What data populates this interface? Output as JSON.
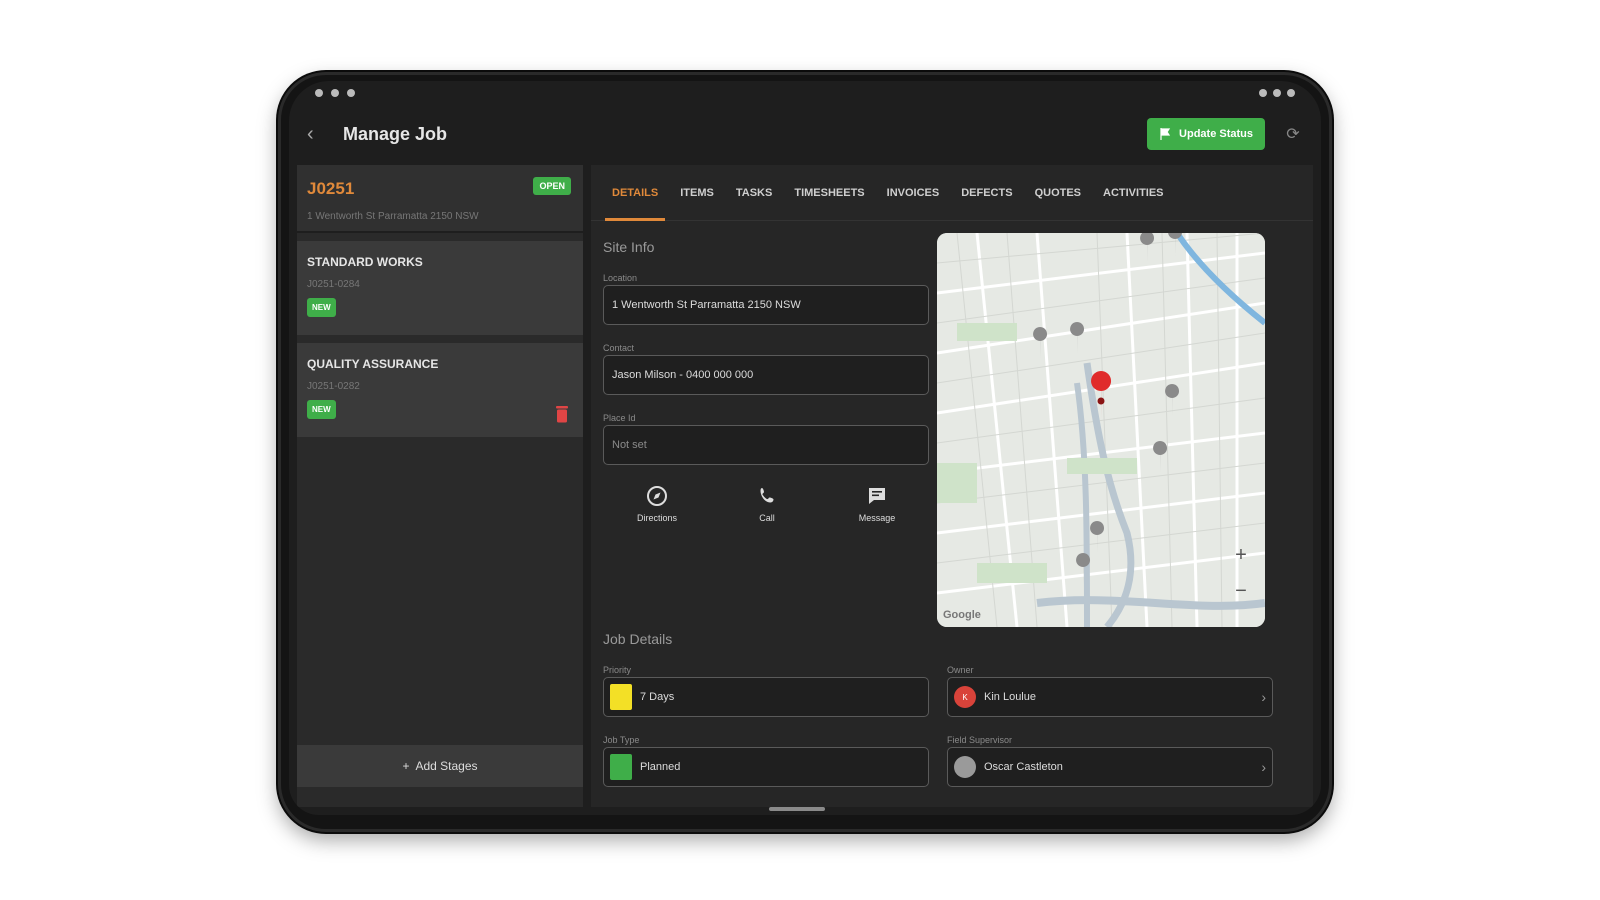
{
  "app": {
    "title": "Manage Job",
    "update_status_label": "Update Status"
  },
  "job": {
    "code": "J0251",
    "status": "OPEN",
    "address": "1 Wentworth St Parramatta 2150 NSW"
  },
  "stages": [
    {
      "title": "STANDARD WORKS",
      "code": "J0251-0284",
      "badge": "NEW"
    },
    {
      "title": "QUALITY ASSURANCE",
      "code": "J0251-0282",
      "badge": "NEW"
    }
  ],
  "add_stages_label": "Add Stages",
  "tabs": [
    "DETAILS",
    "ITEMS",
    "TASKS",
    "TIMESHEETS",
    "INVOICES",
    "DEFECTS",
    "QUOTES",
    "ACTIVITIES"
  ],
  "site_info": {
    "title": "Site Info",
    "location_label": "Location",
    "location_value": "1 Wentworth St Parramatta 2150 NSW",
    "contact_label": "Contact",
    "contact_value": "Jason Milson - 0400 000 000",
    "place_id_label": "Place Id",
    "place_id_value": "Not set"
  },
  "actions": {
    "directions": "Directions",
    "call": "Call",
    "message": "Message"
  },
  "job_details": {
    "title": "Job Details",
    "priority_label": "Priority",
    "priority_value": "7 Days",
    "priority_color": "#f3e026",
    "owner_label": "Owner",
    "owner_value": "Kin Loulue",
    "owner_initial": "K",
    "owner_color": "#d9433a",
    "job_type_label": "Job Type",
    "job_type_value": "Planned",
    "job_type_color": "#3fae49",
    "supervisor_label": "Field Supervisor",
    "supervisor_value": "Oscar Castleton"
  },
  "map": {
    "zoom_in": "+",
    "zoom_out": "−",
    "logo": "Google"
  },
  "colors": {
    "accent": "#e0893a",
    "success": "#3fae49",
    "danger": "#e04545"
  }
}
